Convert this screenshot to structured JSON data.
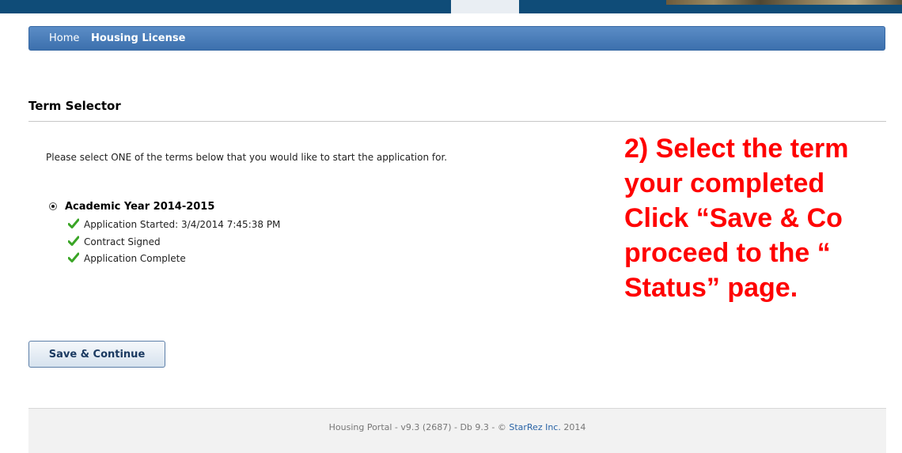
{
  "nav": {
    "home_label": "Home",
    "housing_label": "Housing License"
  },
  "section": {
    "title": "Term Selector",
    "instruction": "Please select ONE of the terms below that you would like to start the application for."
  },
  "term": {
    "label": "Academic Year 2014-2015",
    "selected": true,
    "statuses": [
      "Application Started: 3/4/2014 7:45:38 PM",
      "Contract Signed",
      "Application Complete"
    ]
  },
  "save_button_label": "Save & Continue",
  "annotation": {
    "lines": [
      "2) Select the term",
      "your completed",
      "Click “Save & Co",
      "proceed to the “",
      "Status” page."
    ],
    "color": "#ff0000"
  },
  "footer": {
    "prefix": "Housing Portal - v9.3 (2687) - Db 9.3 - © ",
    "link": "StarRez Inc.",
    "suffix": " 2014"
  },
  "colors": {
    "nav_bar": "#4a7fbd",
    "top_band": "#0f4c78",
    "check": "#3aa526",
    "link": "#2a64a6"
  }
}
